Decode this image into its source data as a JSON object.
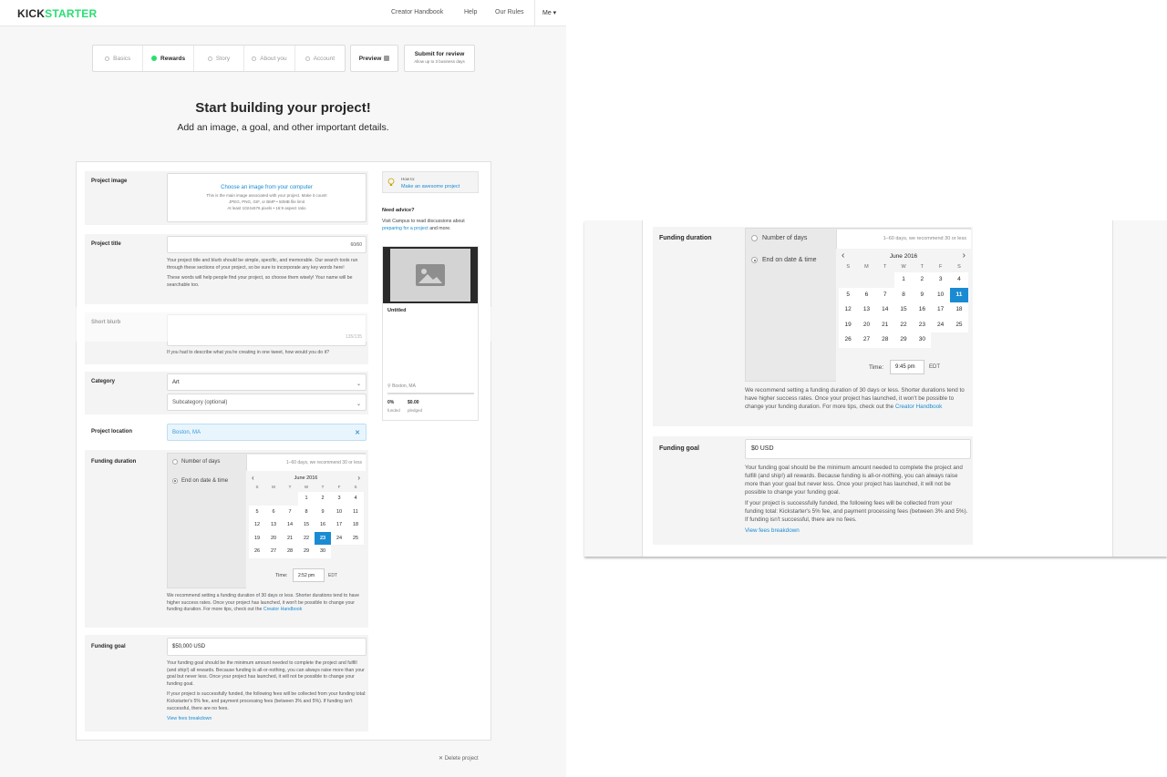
{
  "header": {
    "logo_part1": "KICK",
    "logo_part2": "STARTER",
    "nav": [
      "Creator Handbook",
      "Help",
      "Our Rules"
    ],
    "me": "Me ▾"
  },
  "steps": [
    {
      "label": "Basics",
      "state": "incomplete"
    },
    {
      "label": "Rewards",
      "state": "complete"
    },
    {
      "label": "Story",
      "state": "incomplete"
    },
    {
      "label": "About you",
      "state": "incomplete"
    },
    {
      "label": "Account",
      "state": "incomplete"
    }
  ],
  "preview_label": "Preview",
  "submit": {
    "label": "Submit for review",
    "note": "Allow up to 3 business days"
  },
  "page": {
    "title": "Start building your project!",
    "subtitle": "Add an image, a goal, and other important details."
  },
  "image_section": {
    "label": "Project image",
    "choose": "Choose an image from your computer",
    "hint1": "This is the main image associated with your project. Make it count!",
    "hint2": "JPEG, PNG, GIF, or BMP • 50MB file limit",
    "hint3": "At least 1024x576 pixels • 16:9 aspect ratio"
  },
  "title_section": {
    "label": "Project title",
    "counter": "60/60",
    "help1": "Your project title and blurb should be simple, specific, and memorable. Our search tools run through these sections of your project, so be sure to incorporate any key words here!",
    "help2": "These words will help people find your project, so choose them wisely! Your name will be searchable too."
  },
  "blurb_section": {
    "label": "Short blurb",
    "counter": "135/135",
    "help": "If you had to describe what you're creating in one tweet, how would you do it?"
  },
  "category_section": {
    "label": "Category",
    "value": "Art",
    "sub_placeholder": "Subcategory (optional)"
  },
  "location_section": {
    "label": "Project location",
    "value": "Boston, MA"
  },
  "duration_section": {
    "label": "Funding duration",
    "opt_days": "Number of days",
    "days_hint": "1–60 days, we recommend 30 or less",
    "opt_date": "End on date & time",
    "month": "June 2016",
    "dow": [
      "S",
      "M",
      "T",
      "W",
      "T",
      "F",
      "S"
    ],
    "left_time": "2:52 pm",
    "right_time": "9:45 pm",
    "time_label": "Time:",
    "tz": "EDT",
    "help_pre": "We recommend setting a funding duration of 30 days or less. Shorter durations tend to have higher success rates. Once your project has launched, it won't be possible to change your funding duration. For more tips, check out the ",
    "help_link": "Creator Handbook",
    "left_selected_day": 23,
    "right_selected_day": 11
  },
  "goal_section": {
    "label": "Funding goal",
    "left_value": "$50,000 USD",
    "right_value": "$0 USD",
    "help1": "Your funding goal should be the minimum amount needed to complete the project and fulfill (and ship!) all rewards. Because funding is all-or-nothing, you can always raise more than your goal but never less. Once your project has launched, it will not be possible to change your funding goal.",
    "help2": "If your project is successfully funded, the following fees will be collected from your funding total: Kickstarter's 5% fee, and payment processing fees (between 3% and 5%). If funding isn't successful, there are no fees.",
    "fees_link": "View fees breakdown"
  },
  "sidebar": {
    "howto_label": "How to:",
    "howto_link": "Make an awesome project",
    "advice_title": "Need advice?",
    "advice_pre": "Visit Campus to read discussions about ",
    "advice_link": "preparing for a project",
    "advice_post": " and more.",
    "card_title": "Untitled",
    "card_location": "Boston, MA",
    "funded_value": "0%",
    "funded_label": "funded",
    "pledged_value": "$0.00",
    "pledged_label": "pledged"
  },
  "delete_label": "Delete project",
  "colors": {
    "brand_green": "#2bde73",
    "link_blue": "#1a8bd2",
    "selected_day": "#1a8bd2"
  }
}
